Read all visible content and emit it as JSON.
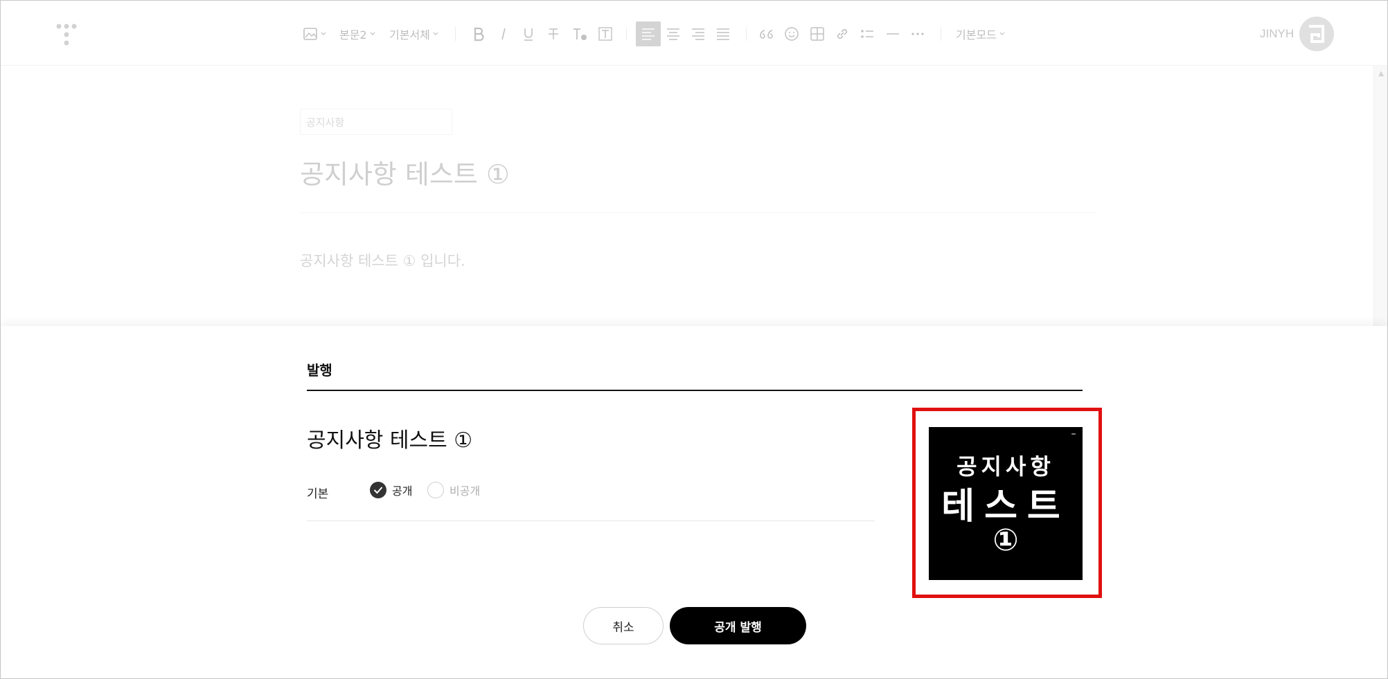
{
  "toolbar": {
    "paragraph_style": "본문2",
    "font": "기본서체",
    "mode": "기본모드",
    "user_name": "JINYH"
  },
  "editor": {
    "category_placeholder": "공지사항",
    "title": "공지사항 테스트 ①",
    "body": "공지사항 테스트 ① 입니다."
  },
  "publish": {
    "heading": "발행",
    "title": "공지사항 테스트 ①",
    "visibility_label": "기본",
    "public_label": "공개",
    "private_label": "비공개",
    "thumbnail": {
      "line1": "공지사항",
      "line2": "테스트",
      "line3": "①"
    },
    "cancel_label": "취소",
    "publish_label": "공개 발행"
  },
  "colors": {
    "highlight": "#e01010",
    "primary_button": "#000000"
  }
}
